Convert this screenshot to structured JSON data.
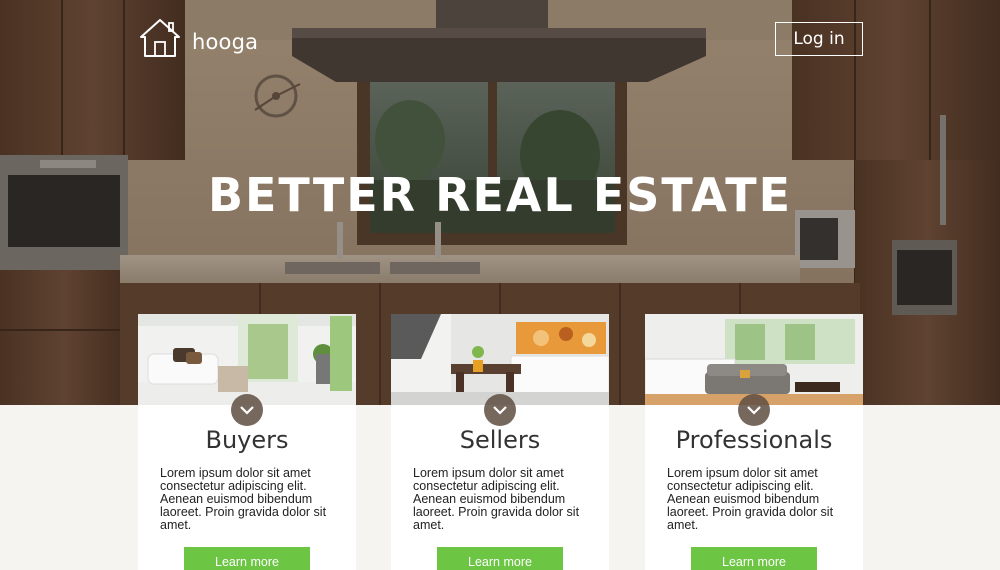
{
  "brand": {
    "name": "hooga",
    "logo_icon": "house-icon"
  },
  "nav": {
    "login_label": "Log in"
  },
  "hero": {
    "headline": "BETTER REAL ESTATE"
  },
  "cards": [
    {
      "title": "Buyers",
      "description": "Lorem ipsum dolor sit amet consectetur adipiscing elit. Aenean euismod bibendum laoreet. Proin gravida dolor sit amet.",
      "cta": "Learn more"
    },
    {
      "title": "Sellers",
      "description": "Lorem ipsum dolor sit amet consectetur adipiscing elit. Aenean euismod bibendum laoreet. Proin gravida dolor sit amet.",
      "cta": "Learn more"
    },
    {
      "title": "Professionals",
      "description": "Lorem ipsum dolor sit amet consectetur adipiscing elit. Aenean euismod bibendum laoreet. Proin gravida dolor sit amet.",
      "cta": "Learn more"
    }
  ],
  "colors": {
    "accent_green": "#6cc644",
    "page_background": "#f5f4f1",
    "badge_brown": "#5f4e42"
  }
}
